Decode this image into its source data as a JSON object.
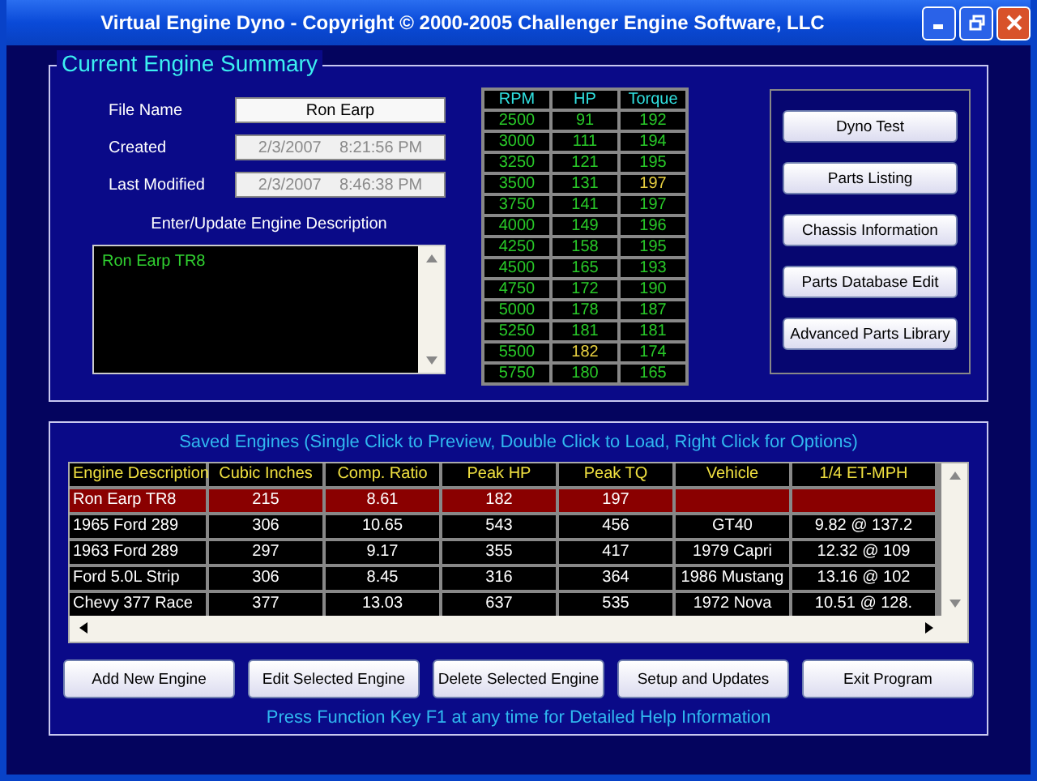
{
  "window": {
    "title": "Virtual Engine Dyno - Copyright © 2000-2005 Challenger Engine Software, LLC"
  },
  "summary": {
    "title": "Current Engine Summary",
    "fields": [
      {
        "label": "File Name",
        "value": "Ron Earp",
        "disabled": false
      },
      {
        "label": "Created",
        "value": "2/3/2007    8:21:56 PM",
        "disabled": true
      },
      {
        "label": "Last Modified",
        "value": "2/3/2007    8:46:38 PM",
        "disabled": true
      }
    ],
    "description_label": "Enter/Update Engine Description",
    "description": "Ron Earp TR8",
    "dyno_table": {
      "columns": [
        "RPM",
        "HP",
        "Torque"
      ],
      "rows": [
        {
          "rpm": "2500",
          "hp": "91",
          "torque": "192",
          "hp_peak": false,
          "torque_peak": false
        },
        {
          "rpm": "3000",
          "hp": "111",
          "torque": "194",
          "hp_peak": false,
          "torque_peak": false
        },
        {
          "rpm": "3250",
          "hp": "121",
          "torque": "195",
          "hp_peak": false,
          "torque_peak": false
        },
        {
          "rpm": "3500",
          "hp": "131",
          "torque": "197",
          "hp_peak": false,
          "torque_peak": true
        },
        {
          "rpm": "3750",
          "hp": "141",
          "torque": "197",
          "hp_peak": false,
          "torque_peak": false
        },
        {
          "rpm": "4000",
          "hp": "149",
          "torque": "196",
          "hp_peak": false,
          "torque_peak": false
        },
        {
          "rpm": "4250",
          "hp": "158",
          "torque": "195",
          "hp_peak": false,
          "torque_peak": false
        },
        {
          "rpm": "4500",
          "hp": "165",
          "torque": "193",
          "hp_peak": false,
          "torque_peak": false
        },
        {
          "rpm": "4750",
          "hp": "172",
          "torque": "190",
          "hp_peak": false,
          "torque_peak": false
        },
        {
          "rpm": "5000",
          "hp": "178",
          "torque": "187",
          "hp_peak": false,
          "torque_peak": false
        },
        {
          "rpm": "5250",
          "hp": "181",
          "torque": "181",
          "hp_peak": false,
          "torque_peak": false
        },
        {
          "rpm": "5500",
          "hp": "182",
          "torque": "174",
          "hp_peak": true,
          "torque_peak": false
        },
        {
          "rpm": "5750",
          "hp": "180",
          "torque": "165",
          "hp_peak": false,
          "torque_peak": false
        }
      ]
    },
    "buttons": [
      "Dyno Test",
      "Parts Listing",
      "Chassis Information",
      "Parts Database Edit",
      "Advanced Parts Library"
    ]
  },
  "saved": {
    "title": "Saved Engines (Single Click to Preview, Double Click to Load, Right Click for Options)",
    "columns": [
      "Engine Description",
      "Cubic Inches",
      "Comp. Ratio",
      "Peak HP",
      "Peak TQ",
      "Vehicle",
      "1/4 ET-MPH"
    ],
    "rows": [
      {
        "cells": [
          "Ron Earp TR8",
          "215",
          "8.61",
          "182",
          "197",
          "",
          ""
        ],
        "selected": true
      },
      {
        "cells": [
          "1965 Ford 289",
          "306",
          "10.65",
          "543",
          "456",
          "GT40",
          "9.82 @ 137.2"
        ],
        "selected": false
      },
      {
        "cells": [
          "1963 Ford 289",
          "297",
          "9.17",
          "355",
          "417",
          "1979 Capri",
          "12.32 @ 109"
        ],
        "selected": false
      },
      {
        "cells": [
          "Ford 5.0L Strip",
          "306",
          "8.45",
          "316",
          "364",
          "1986 Mustang",
          "13.16 @ 102"
        ],
        "selected": false
      },
      {
        "cells": [
          "Chevy 377 Race",
          "377",
          "13.03",
          "637",
          "535",
          "1972 Nova",
          "10.51 @ 128."
        ],
        "selected": false
      }
    ]
  },
  "buttons": [
    "Add New Engine",
    "Edit Selected Engine",
    "Delete Selected Engine",
    "Setup and Updates",
    "Exit Program"
  ],
  "help_text": "Press Function Key F1 at any time for Detailed Help Information"
}
